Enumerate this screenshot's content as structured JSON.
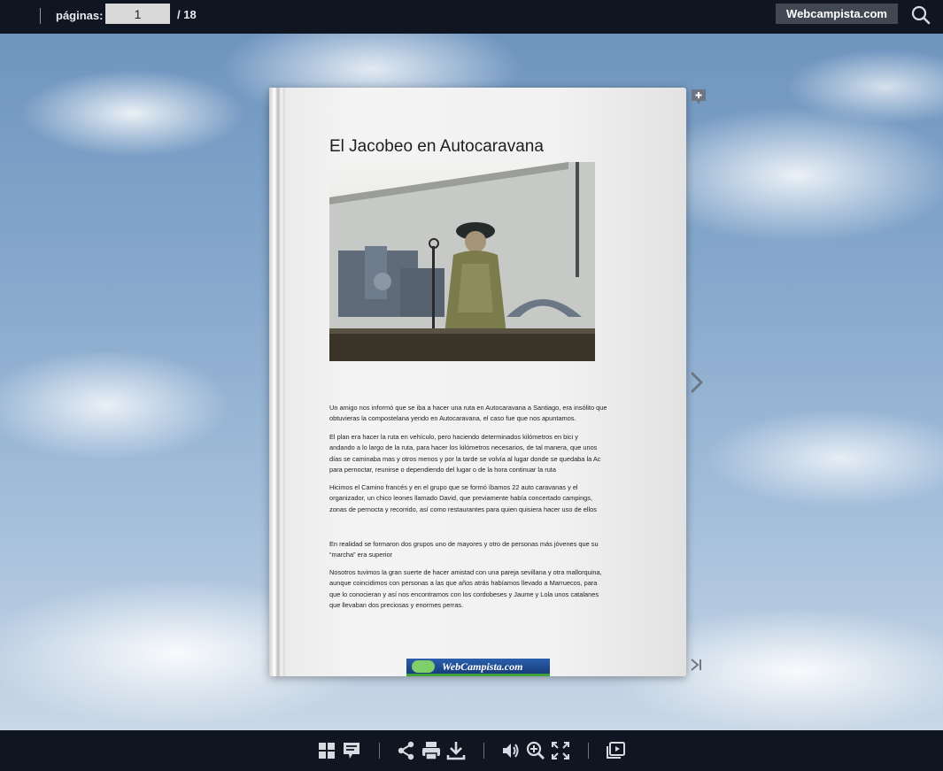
{
  "topbar": {
    "pages_label": "páginas:",
    "page_value": "1",
    "page_total": "/ 18",
    "brand_button": "Webcampista.com",
    "search_icon": "search-icon"
  },
  "page": {
    "title": "El Jacobeo en Autocaravana",
    "photo_description_icon": "pilgrim-mural-photo",
    "paragraphs": [
      [
        "Un amigo nos informó que se iba a hacer una ruta en Autocaravana a Santiago, era insólito que",
        "obtuvieras la compostelana yendo en Autocaravana, el caso fue que nos apuntamos."
      ],
      [
        "El plan era hacer la ruta en vehículo, pero haciendo determinados kilómetros en bici y",
        "andando a lo largo de la ruta, para hacer los kilómetros necesarios, de tal manera, que  unos",
        "días se caminaba mas y otros menos y por la tarde se volvía al lugar donde se quedaba la Ac",
        "para pernoctar, reunirse o dependiendo del lugar  o de la hora continuar la ruta"
      ],
      [
        "Hicimos el Camino francés y en el grupo que se formó íbamos 22 auto caravanas y el",
        "organizador, un chico leones llamado David, que previamente había concertado campings,",
        "zonas de pernocta y recorrido, así como restaurantes para quien quisiera hacer uso de ellos"
      ],
      [
        "En realidad se formaron dos grupos uno de mayores y otro de personas más jóvenes que su",
        "“marcha” era superior"
      ],
      [
        "Nosotros tuvimos la gran suerte de hacer amistad con una pareja sevillana y otra mallorquina,",
        "aunque coincidimos con personas a las que años atrás habíamos llevado a Marruecos, para",
        "que lo conocieran y así nos encontramos con los cordobeses y Jaume y Lola unos  catalanes",
        "que llevaban dos preciosas y enormes perras."
      ]
    ],
    "logo_text": "WebCampista.com"
  },
  "nav": {
    "add_note_icon": "add-note-icon",
    "next_icon": "chevron-right-icon",
    "last_icon": "last-page-icon"
  },
  "toolbar": {
    "icons": [
      "thumbnails-icon",
      "notes-icon",
      "share-icon",
      "print-icon",
      "download-icon",
      "sound-icon",
      "zoom-in-icon",
      "fullscreen-icon",
      "slideshow-icon"
    ]
  },
  "colors": {
    "bar_bg": "#0f1621",
    "brand_bg": "#414853",
    "icon": "#d6dbe2"
  }
}
